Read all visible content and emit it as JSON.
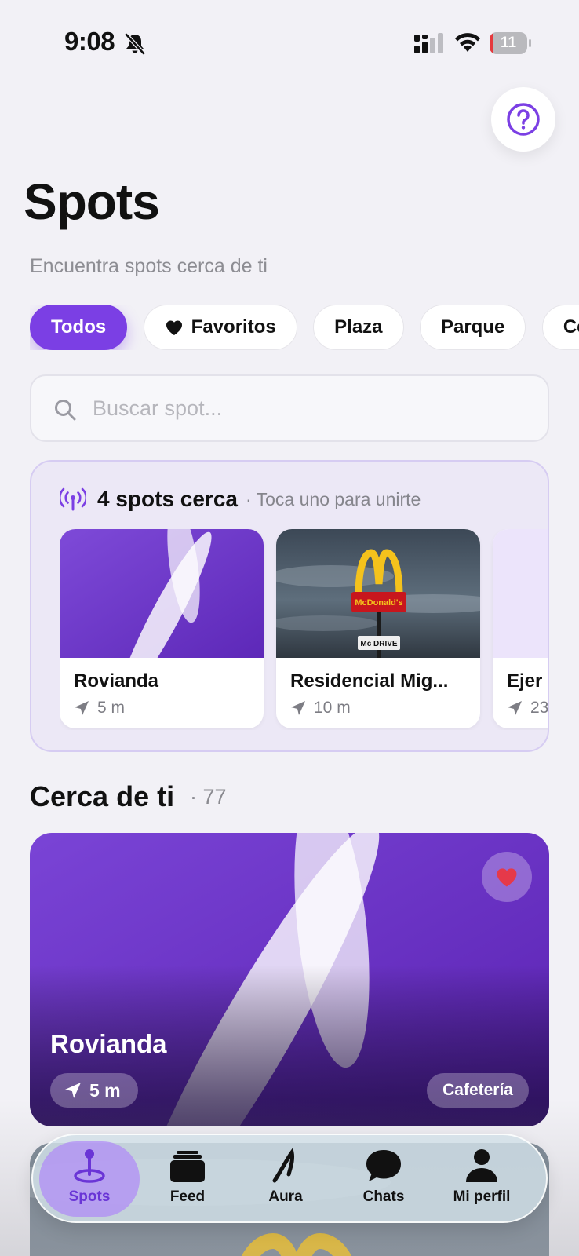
{
  "status_bar": {
    "time": "9:08",
    "battery": "11",
    "battery_level": 0.11
  },
  "header": {
    "title": "Spots",
    "subtitle": "Encuentra spots cerca de ti",
    "help_icon": "question-circle-icon"
  },
  "filters": {
    "chips": [
      {
        "label": "Todos",
        "active": true
      },
      {
        "label": "Favoritos",
        "icon": "heart-icon",
        "active": false
      },
      {
        "label": "Plaza",
        "active": false
      },
      {
        "label": "Parque",
        "active": false
      },
      {
        "label": "Cer",
        "active": false
      }
    ]
  },
  "search": {
    "placeholder": "Buscar spot...",
    "value": ""
  },
  "nearby": {
    "count_label": "4 spots cerca",
    "hint": "· Toca uno para unirte",
    "spots": [
      {
        "name": "Rovianda",
        "distance": "5 m"
      },
      {
        "name": "Residencial Mig...",
        "distance": "10 m"
      },
      {
        "name": "Ejer",
        "distance": "23"
      }
    ]
  },
  "nearby_section": {
    "title": "Cerca de ti",
    "count": "· 77"
  },
  "featured": {
    "name": "Rovianda",
    "distance": "5 m",
    "category": "Cafetería",
    "favorite": true
  },
  "tabbar": {
    "tabs": [
      {
        "label": "Spots",
        "icon": "map-pin-icon",
        "active": true
      },
      {
        "label": "Feed",
        "icon": "cards-stack-icon",
        "active": false
      },
      {
        "label": "Aura",
        "icon": "aura-logo-icon",
        "active": false
      },
      {
        "label": "Chats",
        "icon": "chat-bubble-icon",
        "active": false
      },
      {
        "label": "Mi perfil",
        "icon": "person-icon",
        "active": false
      }
    ]
  },
  "colors": {
    "accent": "#7b3fe4",
    "favorite": "#e5394a",
    "background": "#f2f1f6"
  }
}
